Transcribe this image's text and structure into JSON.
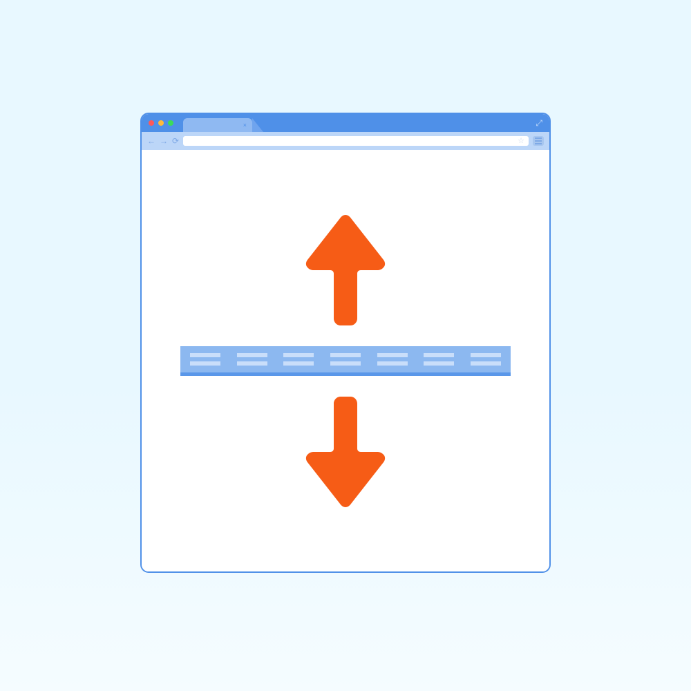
{
  "colors": {
    "accent_blue": "#4f90e8",
    "light_blue": "#8cb8f0",
    "pale_blue": "#c9defa",
    "arrow_orange": "#f65c16"
  },
  "titlebar": {
    "close_tab_glyph": "×",
    "expand_glyph": "⤢"
  },
  "toolbar": {
    "back_glyph": "←",
    "forward_glyph": "→",
    "reload_glyph": "⟳",
    "address_value": "",
    "star_glyph": "☆"
  },
  "content": {
    "band_cells": 7,
    "lines_per_cell": 2
  }
}
